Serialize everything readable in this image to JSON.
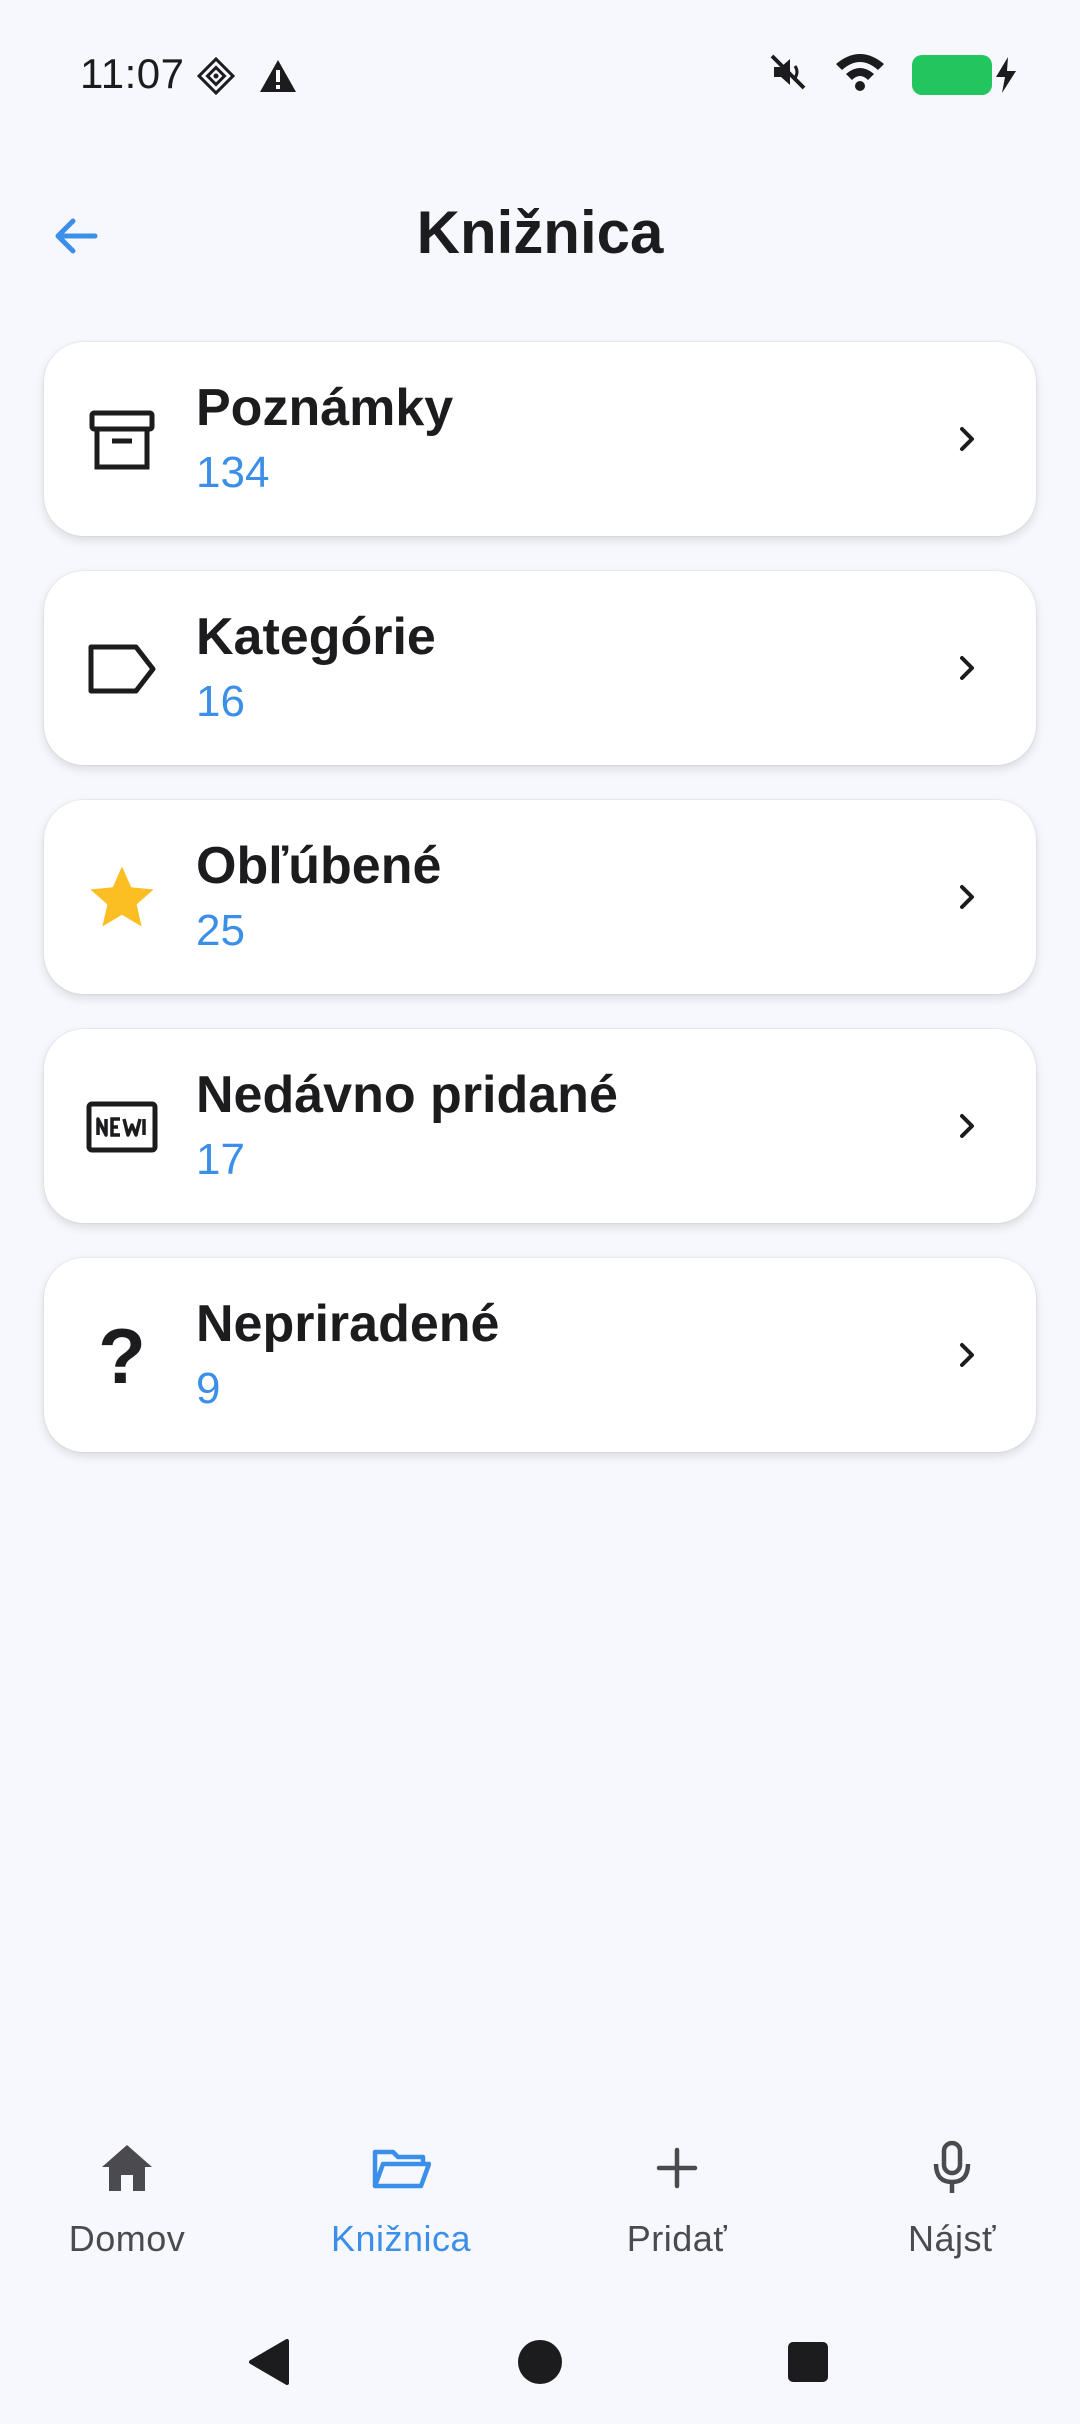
{
  "status_bar": {
    "time": "11:07",
    "icons": [
      "tag-diamond-icon",
      "warning-icon",
      "mute-icon",
      "wifi-icon",
      "battery-charging-icon"
    ],
    "battery_color": "#22c55e"
  },
  "header": {
    "back_icon": "arrow-left-icon",
    "title": "Knižnica"
  },
  "library_items": [
    {
      "title": "Poznámky",
      "count": "134",
      "icon": "archive-box-icon"
    },
    {
      "title": "Kategórie",
      "count": "16",
      "icon": "label-tag-icon"
    },
    {
      "title": "Obľúbené",
      "count": "25",
      "icon": "star-icon"
    },
    {
      "title": "Nedávno pridané",
      "count": "17",
      "icon": "new-badge-icon"
    },
    {
      "title": "Nepriradené",
      "count": "9",
      "icon": "question-mark-icon",
      "glyph": "?"
    }
  ],
  "bottom_nav": {
    "items": [
      {
        "label": "Domov",
        "icon": "home-icon",
        "active": false
      },
      {
        "label": "Knižnica",
        "icon": "folder-open-icon",
        "active": true
      },
      {
        "label": "Pridať",
        "icon": "plus-icon",
        "active": false
      },
      {
        "label": "Nájsť",
        "icon": "microphone-icon",
        "active": false
      }
    ]
  },
  "colors": {
    "accent": "#3b8fe8",
    "star": "#fbbf24",
    "background": "#f6f8fd"
  }
}
